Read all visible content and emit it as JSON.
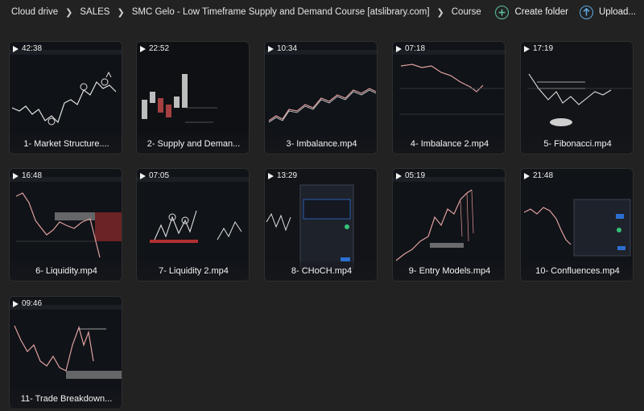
{
  "breadcrumb": [
    "Cloud drive",
    "SALES",
    "SMC Gelo - Low Timeframe Supply and Demand Course [atslibrary.com]",
    "Course"
  ],
  "actions": {
    "create_folder": "Create folder",
    "upload": "Upload..."
  },
  "icons": {
    "create_folder": "plus-circle-icon",
    "upload": "arrow-up-circle-icon",
    "play": "play-icon",
    "separator": "chevron-right-icon"
  },
  "colors": {
    "background": "#222222",
    "create_accent": "#5fc2a0",
    "upload_accent": "#5da8e0"
  },
  "files": [
    {
      "duration": "42:38",
      "name": "1- Market Structure...."
    },
    {
      "duration": "22:52",
      "name": "2- Supply and Deman..."
    },
    {
      "duration": "10:34",
      "name": "3- Imbalance.mp4"
    },
    {
      "duration": "07:18",
      "name": "4- Imbalance 2.mp4"
    },
    {
      "duration": "17:19",
      "name": "5- Fibonacci.mp4"
    },
    {
      "duration": "16:48",
      "name": "6- Liquidity.mp4"
    },
    {
      "duration": "07:05",
      "name": "7- Liquidity 2.mp4"
    },
    {
      "duration": "13:29",
      "name": "8- CHoCH.mp4"
    },
    {
      "duration": "05:19",
      "name": "9- Entry Models.mp4"
    },
    {
      "duration": "21:48",
      "name": "10- Confluences.mp4"
    },
    {
      "duration": "09:46",
      "name": "11- Trade Breakdown..."
    }
  ]
}
